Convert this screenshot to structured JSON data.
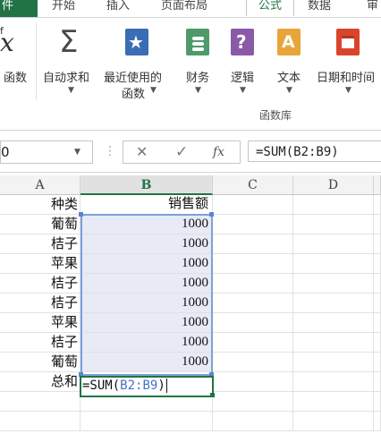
{
  "ribbon_tabs": [
    "件",
    "开始",
    "插入",
    "页面布局",
    "公式",
    "数据",
    "审"
  ],
  "ribbon": {
    "insert_function": {
      "icon": "fx-icon",
      "label": "函数"
    },
    "buttons": [
      {
        "label": "自动求和",
        "icon": "sigma-icon",
        "has_caret": true
      },
      {
        "label": "最近使用的",
        "label2": "函数",
        "icon": "star-book-icon",
        "has_caret": true
      },
      {
        "label": "财务",
        "icon": "finance-book-icon",
        "has_caret": true
      },
      {
        "label": "逻辑",
        "icon": "question-book-icon",
        "has_caret": true
      },
      {
        "label": "文本",
        "icon": "text-book-icon",
        "has_caret": true
      },
      {
        "label": "日期和时间",
        "icon": "calendar-book-icon",
        "has_caret": true
      }
    ],
    "group_label": "函数库",
    "colors": {
      "sigma": "#4a4a4a",
      "star_book": "#3a6db5",
      "finance_book": "#4f9a6a",
      "question_book": "#8a5aa8",
      "text_book": "#e8a53a",
      "calendar_book": "#d8452b",
      "excel_green": "#217346"
    }
  },
  "formula_bar": {
    "name_box": "0",
    "cancel_icon": "✕",
    "enter_icon": "✓",
    "fx_label": "fx",
    "formula": "=SUM(B2:B9)"
  },
  "grid": {
    "columns": [
      "A",
      "B",
      "C",
      "D"
    ],
    "selected_column": "B",
    "rows": [
      {
        "a": "种类",
        "b": "销售额"
      },
      {
        "a": "葡萄",
        "b": "1000"
      },
      {
        "a": "桔子",
        "b": "1000"
      },
      {
        "a": "苹果",
        "b": "1000"
      },
      {
        "a": "桔子",
        "b": "1000"
      },
      {
        "a": "桔子",
        "b": "1000"
      },
      {
        "a": "苹果",
        "b": "1000"
      },
      {
        "a": "桔子",
        "b": "1000"
      },
      {
        "a": "葡萄",
        "b": "1000"
      },
      {
        "a": "总和",
        "b": ""
      }
    ],
    "editing_cell": {
      "prefix": "=SUM(",
      "ref": "B2:B9",
      "suffix": ")"
    },
    "colors": {
      "selection_fill": "#e8eaf6",
      "selection_border": "#7ba2d9",
      "ref_text": "#4472c4"
    }
  }
}
